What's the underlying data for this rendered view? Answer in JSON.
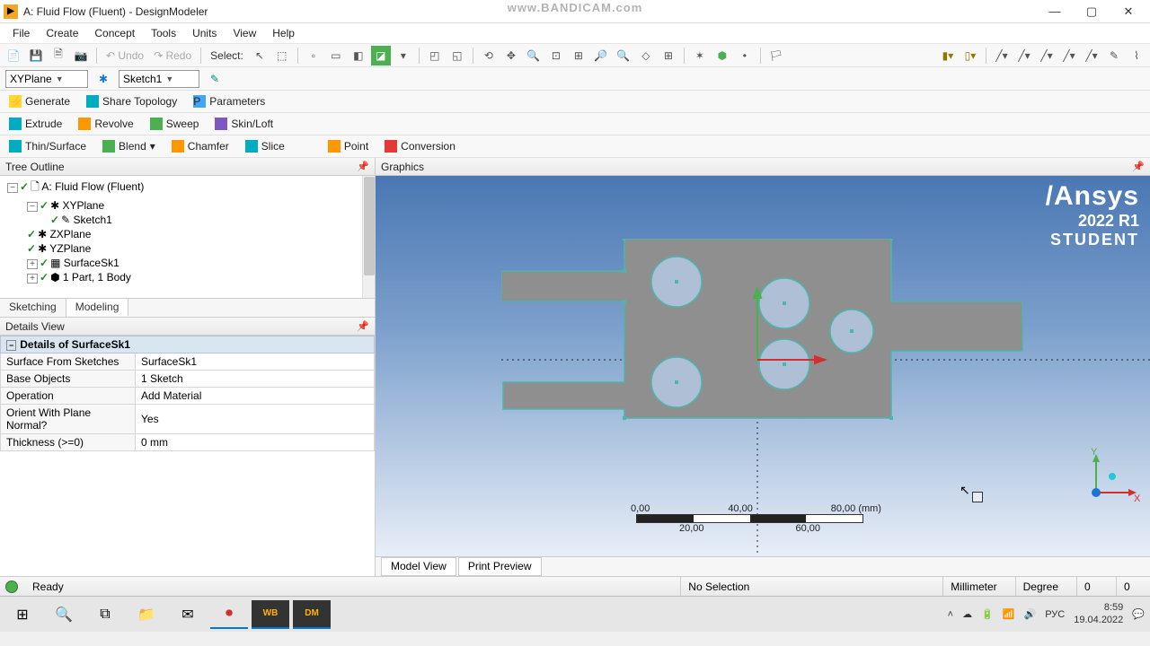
{
  "watermark": "www.BANDICAM.com",
  "window_title": "A: Fluid Flow (Fluent) - DesignModeler",
  "menu": [
    "File",
    "Create",
    "Concept",
    "Tools",
    "Units",
    "View",
    "Help"
  ],
  "toolbar1": {
    "undo": "Undo",
    "redo": "Redo",
    "select_label": "Select:"
  },
  "selectbar": {
    "plane": "XYPlane",
    "sketch": "Sketch1"
  },
  "featurebar1": {
    "generate": "Generate",
    "share_topology": "Share Topology",
    "parameters": "Parameters"
  },
  "featurebar2": {
    "extrude": "Extrude",
    "revolve": "Revolve",
    "sweep": "Sweep",
    "skin_loft": "Skin/Loft"
  },
  "featurebar3": {
    "thin_surface": "Thin/Surface",
    "blend": "Blend",
    "chamfer": "Chamfer",
    "slice": "Slice",
    "point": "Point",
    "conversion": "Conversion"
  },
  "tree_outline": {
    "title": "Tree Outline",
    "root": "A: Fluid Flow (Fluent)",
    "nodes": {
      "xy": "XYPlane",
      "sketch1": "Sketch1",
      "zx": "ZXPlane",
      "yz": "YZPlane",
      "surface": "SurfaceSk1",
      "part": "1 Part, 1 Body"
    }
  },
  "tabs": {
    "sketching": "Sketching",
    "modeling": "Modeling"
  },
  "details": {
    "title": "Details View",
    "header": "Details of SurfaceSk1",
    "rows": {
      "surface_from_sketches": {
        "k": "Surface From Sketches",
        "v": "SurfaceSk1"
      },
      "base_objects": {
        "k": "Base Objects",
        "v": "1 Sketch"
      },
      "operation": {
        "k": "Operation",
        "v": "Add Material"
      },
      "orient": {
        "k": "Orient With Plane Normal?",
        "v": "Yes"
      },
      "thickness": {
        "k": "Thickness (>=0)",
        "v": "0 mm"
      }
    }
  },
  "graphics": {
    "title": "Graphics",
    "brand": "Ansys",
    "version": "2022 R1",
    "edition": "STUDENT",
    "scale": {
      "t0": "0,00",
      "t40": "40,00",
      "t80": "80,00 (mm)",
      "t20": "20,00",
      "t60": "60,00"
    },
    "axis_x": "X",
    "axis_y": "Y",
    "tabs": {
      "model_view": "Model View",
      "print_preview": "Print Preview"
    }
  },
  "statusbar": {
    "ready": "Ready",
    "selection": "No Selection",
    "length_unit": "Millimeter",
    "angle_unit": "Degree",
    "val1": "0",
    "val2": "0"
  },
  "taskbar": {
    "lang": "РУС",
    "time": "8:59",
    "date": "19.04.2022"
  }
}
